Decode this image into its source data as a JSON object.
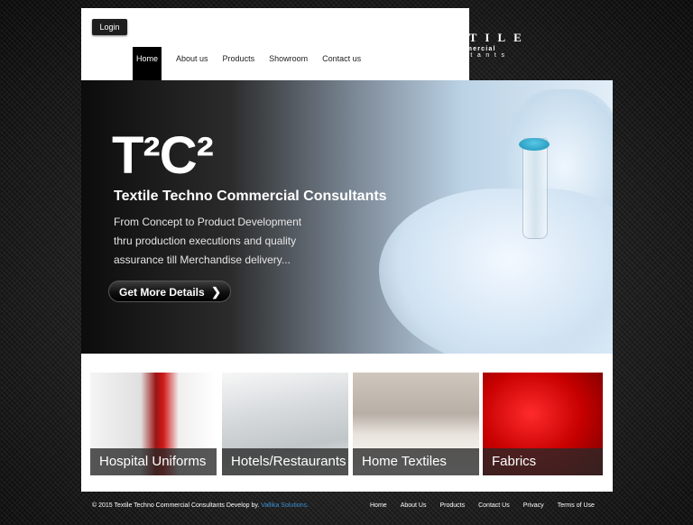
{
  "header": {
    "login_label": "Login",
    "nav": [
      "Home",
      "About us",
      "Products",
      "Showroom",
      "Contact us"
    ]
  },
  "logo": {
    "line1": "TEXTILE",
    "line2": "TechnoCommercial",
    "line3": "Consultants"
  },
  "hero": {
    "title": "T²C²",
    "subtitle": "Textile Techno  Commercial  Consultants",
    "description": [
      "From Concept to Product Development",
      "thru production executions and quality",
      "assurance till Merchandise delivery..."
    ],
    "cta_label": "Get More Details"
  },
  "categories": [
    "Hospital Uniforms",
    "Hotels/Restaurants",
    "Home Textiles",
    "Fabrics"
  ],
  "footer": {
    "copyright": "© 2015 Textile Techno Commercial Consultants Develop by.",
    "developer": "Vallika Solutions.",
    "links": [
      "Home",
      "About Us",
      "Products",
      "Contact Us",
      "Privacy",
      "Terms of Use"
    ]
  },
  "icons": [
    "chevron-right-icon"
  ]
}
